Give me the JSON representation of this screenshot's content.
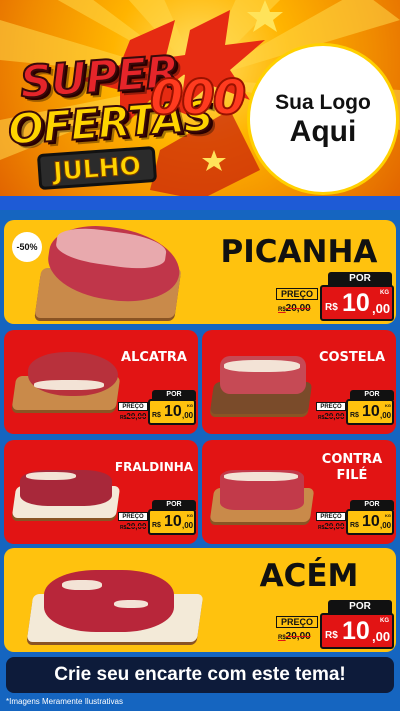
{
  "header": {
    "title_line1": "SUPER",
    "title_line2": "OFERTAS",
    "month": "JULHO",
    "zeros": "000",
    "brand_line1": "Sua Logo",
    "brand_line2": "Aqui"
  },
  "products": [
    {
      "name": "PICANHA",
      "badge": "-50%",
      "tag_por": "POR",
      "tag_preco": "PREÇO",
      "old_currency": "R$",
      "old_price": "20,00",
      "currency": "R$",
      "price_int": "10",
      "price_dec": ",00",
      "unit": "KG"
    },
    {
      "name": "ALCATRA",
      "tag_por": "POR",
      "tag_preco": "PREÇO",
      "old_currency": "R$",
      "old_price": "20,00",
      "currency": "R$",
      "price_int": "10",
      "price_dec": ",00",
      "unit": "KG"
    },
    {
      "name": "COSTELA",
      "tag_por": "POR",
      "tag_preco": "PREÇO",
      "old_currency": "R$",
      "old_price": "20,00",
      "currency": "R$",
      "price_int": "10",
      "price_dec": ",00",
      "unit": "KG"
    },
    {
      "name": "FRALDINHA",
      "tag_por": "POR",
      "tag_preco": "PREÇO",
      "old_currency": "R$",
      "old_price": "20,00",
      "currency": "R$",
      "price_int": "10",
      "price_dec": ",00",
      "unit": "KG"
    },
    {
      "name_line1": "CONTRA",
      "name_line2": "FILÉ",
      "tag_por": "POR",
      "tag_preco": "PREÇO",
      "old_currency": "R$",
      "old_price": "20,00",
      "currency": "R$",
      "price_int": "10",
      "price_dec": ",00",
      "unit": "KG"
    },
    {
      "name": "ACÉM",
      "tag_por": "POR",
      "tag_preco": "PREÇO",
      "old_currency": "R$",
      "old_price": "20,00",
      "currency": "R$",
      "price_int": "10",
      "price_dec": ",00",
      "unit": "KG"
    }
  ],
  "footer": {
    "cta": "Crie seu encarte com este tema!",
    "disclaimer": "*Imagens Meramente Ilustrativas"
  },
  "colors": {
    "yellow_card": "#ffc20e",
    "red_card": "#e21414",
    "background": "#1565c0",
    "cta_bg": "#0d1b3a"
  }
}
